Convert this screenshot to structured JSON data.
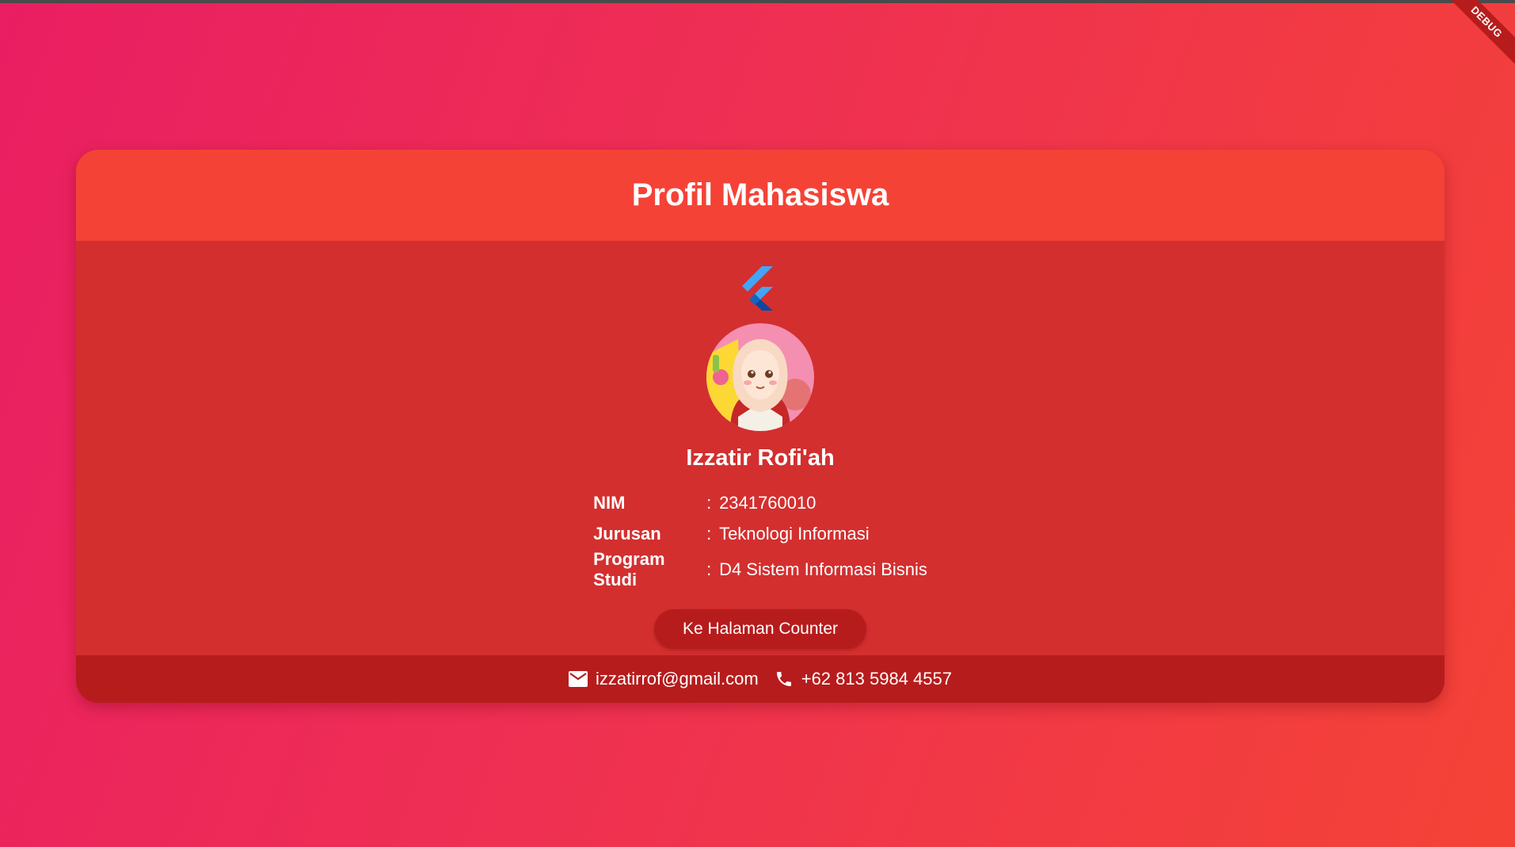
{
  "debug_banner": "DEBUG",
  "card": {
    "title": "Profil Mahasiswa",
    "logo_icon": "flutter-logo-icon",
    "avatar_icon": "avatar-hijab-girl-illustration",
    "name": "Izzatir Rofi'ah",
    "info": [
      {
        "label": "NIM",
        "colon": ":",
        "value": "2341760010"
      },
      {
        "label": "Jurusan",
        "colon": ":",
        "value": "Teknologi Informasi"
      },
      {
        "label": "Program Studi",
        "colon": ":",
        "value": "D4 Sistem Informasi Bisnis"
      }
    ],
    "button_label": "Ke Halaman Counter"
  },
  "footer": {
    "email_icon": "email-icon",
    "email": "izzatirrof@gmail.com",
    "phone_icon": "phone-icon",
    "phone": "+62 813 5984 4557"
  },
  "colors": {
    "header": "#f44336",
    "body": "#d32f2f",
    "footer": "#b71c1c",
    "button": "#b71c1c",
    "background_start": "#e91e63",
    "background_end": "#f44336"
  }
}
